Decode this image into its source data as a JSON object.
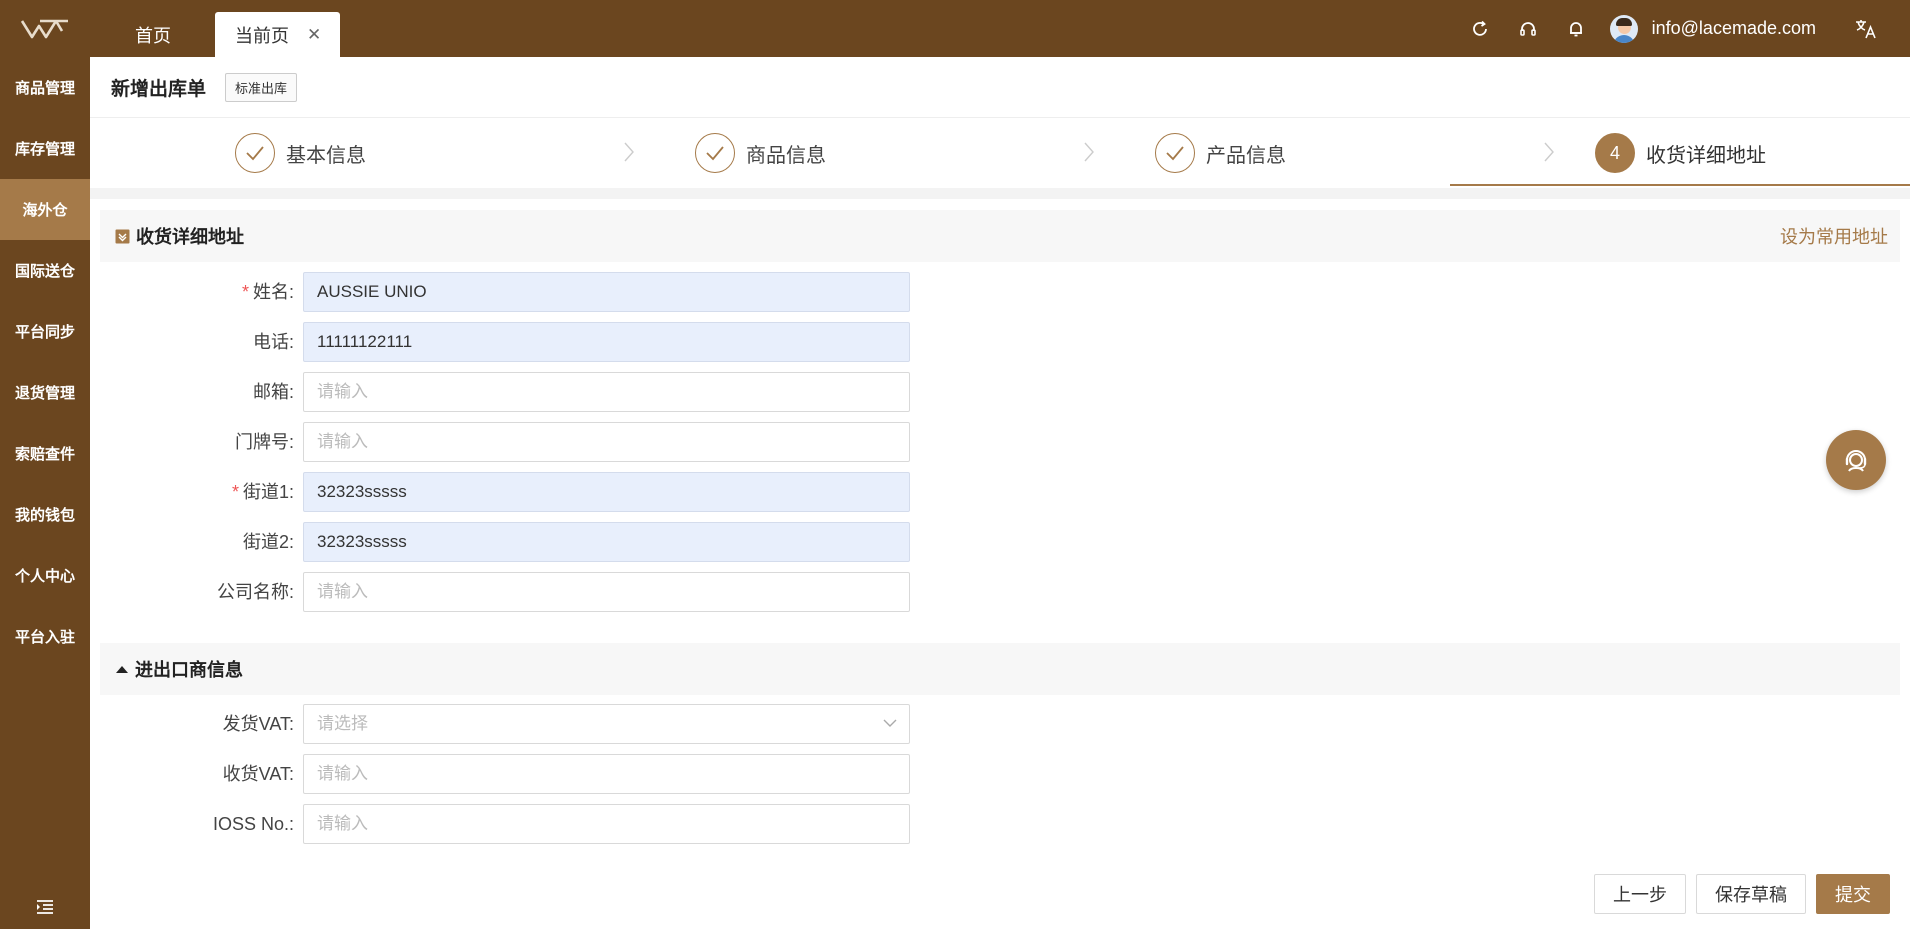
{
  "topbar": {
    "tabs": [
      {
        "label": "首页"
      },
      {
        "label": "当前页"
      }
    ],
    "user_email": "info@lacemade.com"
  },
  "sidebar": {
    "items": [
      {
        "label": "商品管理"
      },
      {
        "label": "库存管理"
      },
      {
        "label": "海外仓"
      },
      {
        "label": "国际送仓"
      },
      {
        "label": "平台同步"
      },
      {
        "label": "退货管理"
      },
      {
        "label": "索赔查件"
      },
      {
        "label": "我的钱包"
      },
      {
        "label": "个人中心"
      },
      {
        "label": "平台入驻"
      }
    ],
    "active_index": 2
  },
  "page": {
    "title": "新增出库单",
    "tag": "标准出库"
  },
  "steps": [
    {
      "label": "基本信息",
      "status": "done"
    },
    {
      "label": "商品信息",
      "status": "done"
    },
    {
      "label": "产品信息",
      "status": "done"
    },
    {
      "number": "4",
      "label": "收货详细地址",
      "status": "active"
    }
  ],
  "address_section": {
    "title": "收货详细地址",
    "link": "设为常用地址",
    "fields": [
      {
        "label": "姓名:",
        "required": true,
        "value": "AUSSIE UNIO",
        "placeholder": "请输入"
      },
      {
        "label": "电话:",
        "required": false,
        "value": "11111122111",
        "placeholder": "请输入"
      },
      {
        "label": "邮箱:",
        "required": false,
        "value": "",
        "placeholder": "请输入"
      },
      {
        "label": "门牌号:",
        "required": false,
        "value": "",
        "placeholder": "请输入"
      },
      {
        "label": "街道1:",
        "required": true,
        "value": "32323sssss",
        "placeholder": "请输入"
      },
      {
        "label": "街道2:",
        "required": false,
        "value": "32323sssss",
        "placeholder": "请输入"
      },
      {
        "label": "公司名称:",
        "required": false,
        "value": "",
        "placeholder": "请输入"
      }
    ]
  },
  "import_section": {
    "title": "进出口商信息",
    "fields": [
      {
        "label": "发货VAT:",
        "value": "",
        "placeholder": "请选择",
        "type": "select"
      },
      {
        "label": "收货VAT:",
        "value": "",
        "placeholder": "请输入",
        "type": "input"
      },
      {
        "label": "IOSS No.:",
        "value": "",
        "placeholder": "请输入",
        "type": "input"
      }
    ]
  },
  "actions": {
    "prev": "上一步",
    "save_draft": "保存草稿",
    "submit": "提交"
  },
  "colors": {
    "brand_dark": "#6b461f",
    "brand_accent": "#a57a49",
    "required": "#e55555",
    "filled_bg": "#e8effc"
  }
}
